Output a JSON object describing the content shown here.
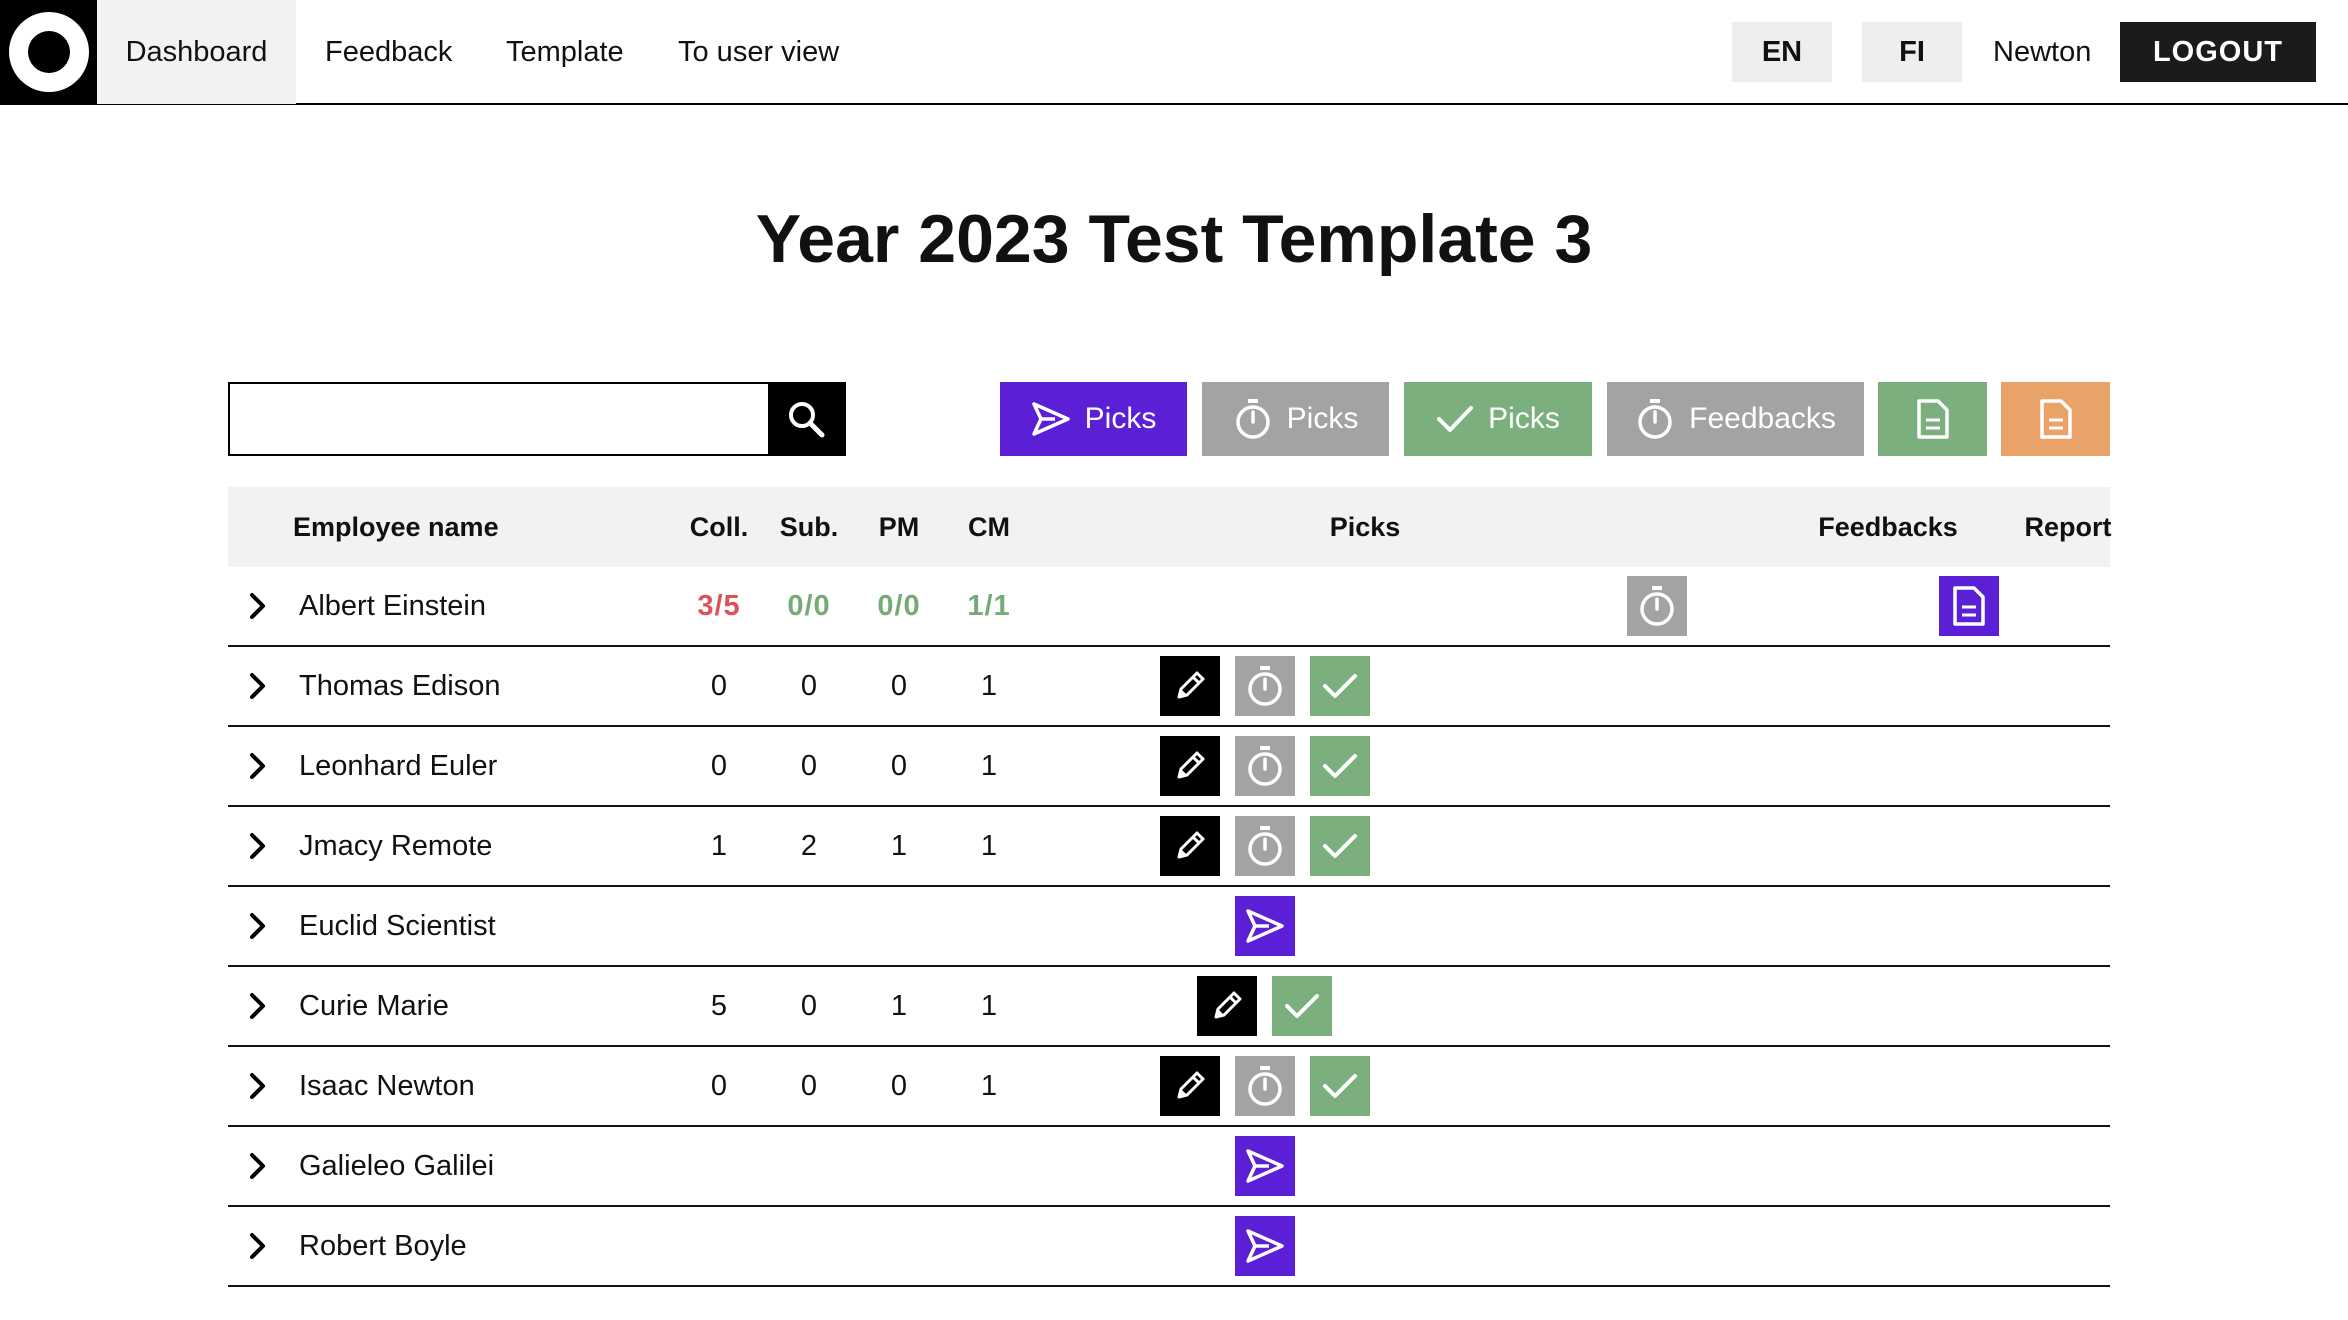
{
  "nav": {
    "items": [
      "Dashboard",
      "Feedback",
      "Template",
      "To user view"
    ],
    "active": "Dashboard",
    "lang_en": "EN",
    "lang_fi": "FI",
    "user": "Newton",
    "logout": "LOGOUT"
  },
  "page": {
    "title": "Year 2023 Test Template 3"
  },
  "search": {
    "value": "",
    "placeholder": ""
  },
  "filters": [
    {
      "label": "Picks",
      "icon": "send-icon",
      "color": "#5b1fd6"
    },
    {
      "label": "Picks",
      "icon": "timer-icon",
      "color": "#a3a3a3"
    },
    {
      "label": "Picks",
      "icon": "check-icon",
      "color": "#7bb07e"
    },
    {
      "label": "Feedbacks",
      "icon": "timer-icon",
      "color": "#a3a3a3"
    },
    {
      "label": "",
      "icon": "document-icon",
      "color": "#7bb07e"
    },
    {
      "label": "",
      "icon": "document-icon",
      "color": "#e9a267"
    }
  ],
  "table": {
    "headers": {
      "name": "Employee name",
      "coll": "Coll.",
      "sub": "Sub.",
      "pm": "PM",
      "cm": "CM",
      "picks": "Picks",
      "feedbacks": "Feedbacks",
      "report": "Report"
    },
    "summary": {
      "name": "Albert Einstein",
      "coll": "3/5",
      "sub": "0/0",
      "pm": "0/0",
      "cm": "1/1",
      "feedback_icon": "timer-icon",
      "report_icon": "document-icon"
    },
    "rows": [
      {
        "name": "Thomas Edison",
        "coll": "0",
        "sub": "0",
        "pm": "0",
        "cm": "1",
        "picks": [
          "edit",
          "timer",
          "done"
        ]
      },
      {
        "name": "Leonhard Euler",
        "coll": "0",
        "sub": "0",
        "pm": "0",
        "cm": "1",
        "picks": [
          "edit",
          "timer",
          "done"
        ]
      },
      {
        "name": "Jmacy Remote",
        "coll": "1",
        "sub": "2",
        "pm": "1",
        "cm": "1",
        "picks": [
          "edit",
          "timer",
          "done"
        ]
      },
      {
        "name": "Euclid Scientist",
        "coll": "",
        "sub": "",
        "pm": "",
        "cm": "",
        "picks": [
          "send"
        ]
      },
      {
        "name": "Curie Marie",
        "coll": "5",
        "sub": "0",
        "pm": "1",
        "cm": "1",
        "picks": [
          "edit",
          "done"
        ]
      },
      {
        "name": "Isaac Newton",
        "coll": "0",
        "sub": "0",
        "pm": "0",
        "cm": "1",
        "picks": [
          "edit",
          "timer",
          "done"
        ]
      },
      {
        "name": "Galieleo Galilei",
        "coll": "",
        "sub": "",
        "pm": "",
        "cm": "",
        "picks": [
          "send"
        ]
      },
      {
        "name": "Robert Boyle",
        "coll": "",
        "sub": "",
        "pm": "",
        "cm": "",
        "picks": [
          "send"
        ]
      }
    ]
  }
}
